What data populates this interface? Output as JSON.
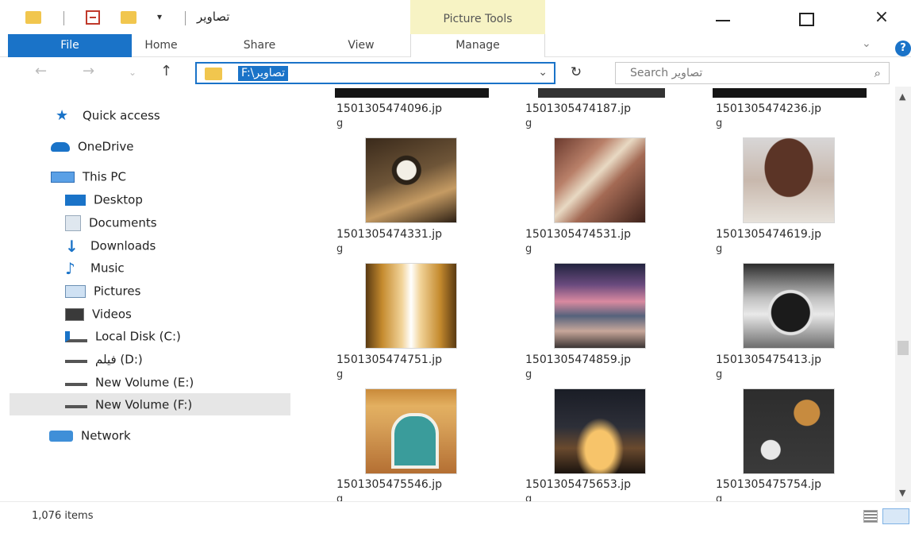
{
  "window": {
    "title": "تصاوير",
    "context_tab": "Picture Tools",
    "minimize_label": "",
    "close_label": "×"
  },
  "ribbon": {
    "tabs": [
      "File",
      "Home",
      "Share",
      "View",
      "Manage"
    ],
    "help_label": "?"
  },
  "address": {
    "path": "F:\\تصاوير",
    "refresh_icon": "↻",
    "search_placeholder": "Search تصاوير"
  },
  "sidebar": {
    "items": [
      {
        "label": "Quick access",
        "icon": "star-icon"
      },
      {
        "label": "OneDrive",
        "icon": "cloud-icon"
      },
      {
        "label": "This PC",
        "icon": "computer-icon"
      },
      {
        "label": "Desktop",
        "icon": "desktop-icon"
      },
      {
        "label": "Documents",
        "icon": "documents-icon"
      },
      {
        "label": "Downloads",
        "icon": "download-icon"
      },
      {
        "label": "Music",
        "icon": "music-icon"
      },
      {
        "label": "Pictures",
        "icon": "pictures-icon"
      },
      {
        "label": "Videos",
        "icon": "video-icon"
      },
      {
        "label": "Local Disk (C:)",
        "icon": "local-disk-icon"
      },
      {
        "label": "فيلم (D:)",
        "icon": "drive-icon"
      },
      {
        "label": "New Volume (E:)",
        "icon": "drive-icon"
      },
      {
        "label": "New Volume (F:)",
        "icon": "drive-icon"
      },
      {
        "label": "Network",
        "icon": "network-icon"
      }
    ],
    "selected": "New Volume (F:)"
  },
  "files": {
    "top_partial": [
      {
        "name_line1": "1501305474096.jp",
        "name_line2": "g"
      },
      {
        "name_line1": "1501305474187.jp",
        "name_line2": "g"
      },
      {
        "name_line1": "1501305474236.jp",
        "name_line2": "g"
      }
    ],
    "rows": [
      [
        {
          "name_line1": "1501305474331.jp",
          "name_line2": "g",
          "thumb": "clock"
        },
        {
          "name_line1": "1501305474531.jp",
          "name_line2": "g",
          "thumb": "violin"
        },
        {
          "name_line1": "1501305474619.jp",
          "name_line2": "g",
          "thumb": "cupcake"
        }
      ],
      [
        {
          "name_line1": "1501305474751.jp",
          "name_line2": "g",
          "thumb": "library"
        },
        {
          "name_line1": "1501305474859.jp",
          "name_line2": "g",
          "thumb": "lake"
        },
        {
          "name_line1": "1501305475413.jp",
          "name_line2": "g",
          "thumb": "phone"
        }
      ],
      [
        {
          "name_line1": "1501305475546.jp",
          "name_line2": "g",
          "thumb": "door"
        },
        {
          "name_line1": "1501305475653.jp",
          "name_line2": "g",
          "thumb": "rock"
        },
        {
          "name_line1": "1501305475754.jp",
          "name_line2": "g",
          "thumb": "spoon"
        }
      ]
    ]
  },
  "status": {
    "item_count": "1,076 items"
  },
  "colors": {
    "accent": "#1a73c8",
    "folder": "#f1c64e",
    "context_tab_bg": "#f7f3c4"
  }
}
